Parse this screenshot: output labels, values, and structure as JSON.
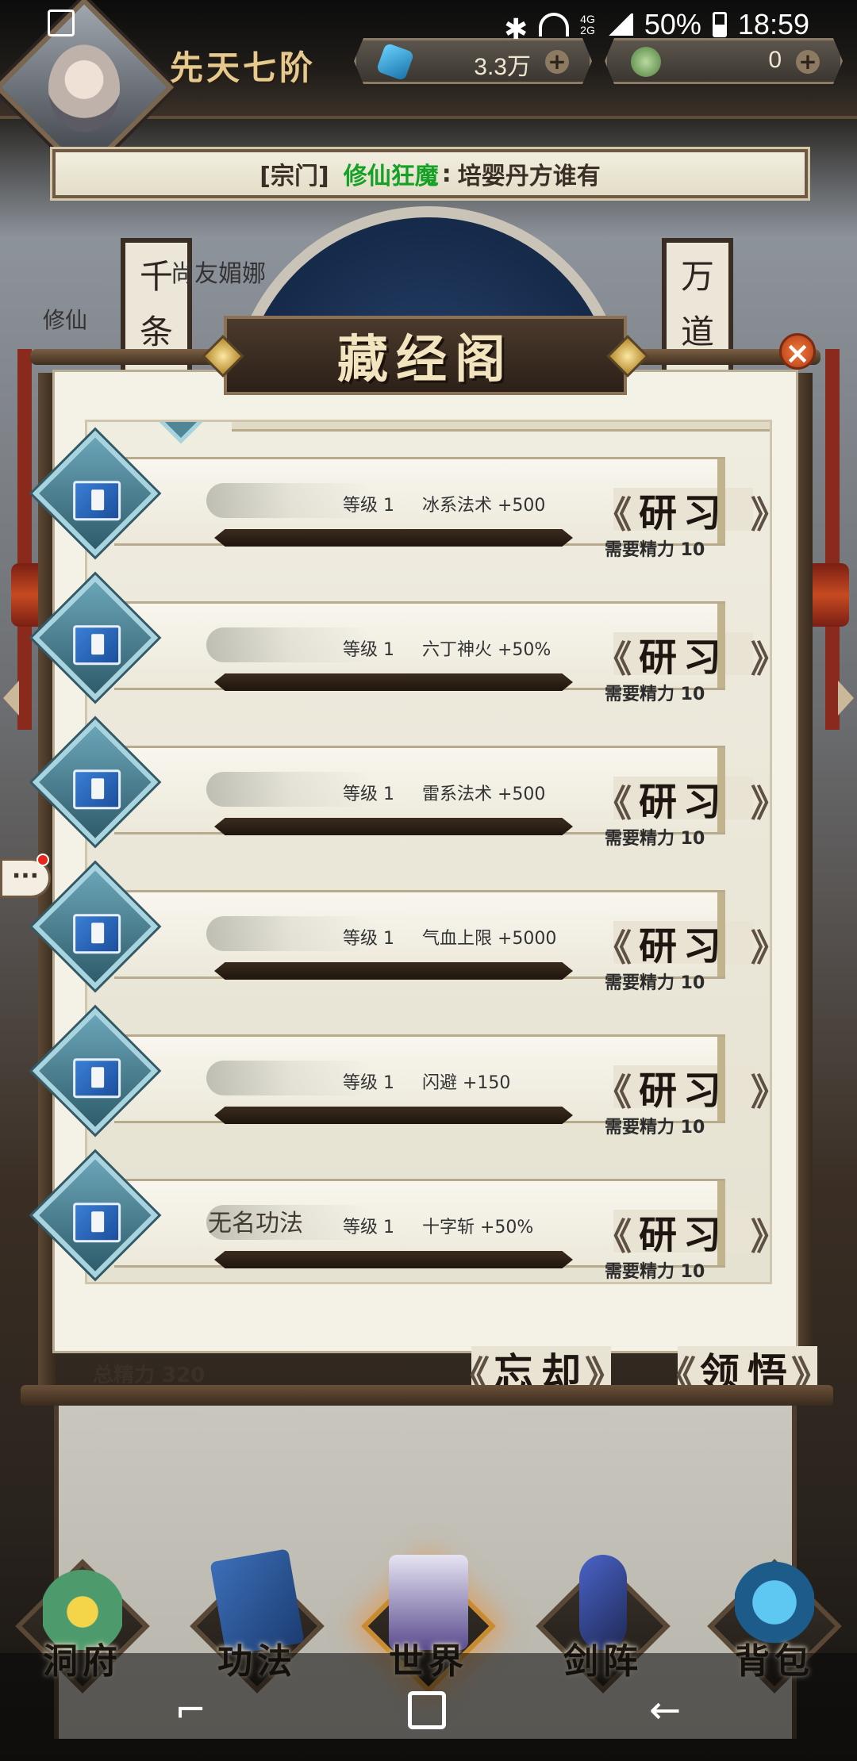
{
  "status_bar": {
    "network": [
      "4G",
      "2G"
    ],
    "battery": "50%",
    "time": "18:59"
  },
  "header": {
    "rank": "先天七阶",
    "resources": [
      {
        "name": "spirit-stone",
        "value": "3.3万",
        "color": "#3ba6e0"
      },
      {
        "name": "jade",
        "value": "0",
        "color": "#7fb26a"
      }
    ]
  },
  "scene": {
    "banner_left": "千条",
    "banner_right": "万道",
    "partial_name": "尚友媚娜",
    "partial_value": "修仙"
  },
  "announcement": {
    "tag": "[宗门]",
    "player": "修仙狂魔",
    "separator": ":",
    "message": "培婴丹方谁有",
    "player_color": "#14a126"
  },
  "panel": {
    "title": "藏经阁",
    "study_label": "研习",
    "need_label": "需要精力 10",
    "level_label": "等级 1",
    "skills": [
      {
        "name": "",
        "effect": "冰系法术 +500",
        "progress": 0
      },
      {
        "name": "",
        "effect": "六丁神火 +50%",
        "progress": 0
      },
      {
        "name": "",
        "effect": "雷系法术 +500",
        "progress": 0
      },
      {
        "name": "",
        "effect": "气血上限 +5000",
        "progress": 0
      },
      {
        "name": "",
        "effect": "闪避 +150",
        "progress": 0
      },
      {
        "name": "无名功法",
        "effect": "十字斩 +50%",
        "progress": 0
      }
    ],
    "total_energy": "总精力 320",
    "forget_label": "忘却",
    "comprehend_label": "领悟"
  },
  "chat": {
    "label": "···"
  },
  "bottom_nav": [
    {
      "id": "home",
      "label": "洞府"
    },
    {
      "id": "skills",
      "label": "功法"
    },
    {
      "id": "world",
      "label": "世界"
    },
    {
      "id": "formation",
      "label": "剑阵"
    },
    {
      "id": "bag",
      "label": "背包"
    }
  ]
}
